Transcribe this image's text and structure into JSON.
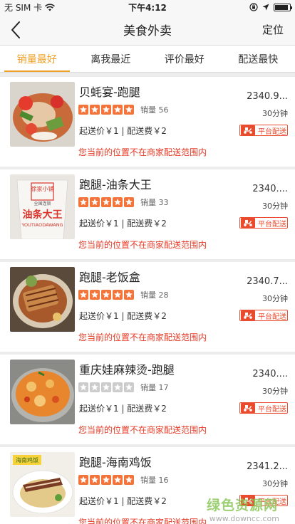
{
  "status_bar": {
    "carrier": "无 SIM 卡",
    "time": "下午4:12",
    "icons": [
      "wifi-icon",
      "lock-rotation-icon",
      "location-icon",
      "battery-icon"
    ]
  },
  "nav": {
    "title": "美食外卖",
    "action": "定位",
    "back_icon": "back-chevron-icon"
  },
  "tabs": [
    {
      "label": "销量最好",
      "active": true
    },
    {
      "label": "离我最近",
      "active": false
    },
    {
      "label": "评价最好",
      "active": false
    },
    {
      "label": "配送最快",
      "active": false
    }
  ],
  "colors": {
    "accent": "#f0a12a",
    "star": "#f2743a",
    "star_empty": "#cccccc",
    "alert_red": "#e83a25",
    "badge_red": "#e84b2d"
  },
  "shops": [
    {
      "name": "贝蚝宴-跑腿",
      "distance": "2340.9...",
      "stars": 5,
      "sales": "销量 56",
      "time": "30分钟",
      "fees": "起送价￥1 | 配送费￥2",
      "badge": "平台配送",
      "notice": "您当前的位置不在商家配送范围内",
      "image": "seafood-salad-photo"
    },
    {
      "name": "跑腿-油条大王",
      "distance": "2340....",
      "stars": 5,
      "sales": "销量 33",
      "time": "30分钟",
      "fees": "起送价￥1 | 配送费￥2",
      "badge": "平台配送",
      "notice": "您当前的位置不在商家配送范围内",
      "image": "youtiao-cup-photo",
      "image_text": [
        "徐家小铺",
        "全国连锁",
        "油条大王",
        "YOUTIAODAWANG"
      ]
    },
    {
      "name": "跑腿-老饭盒",
      "distance": "2340.7...",
      "stars": 5,
      "sales": "销量 28",
      "time": "30分钟",
      "fees": "起送价￥1 | 配送费￥2",
      "badge": "平台配送",
      "notice": "您当前的位置不在商家配送范围内",
      "image": "rice-box-photo"
    },
    {
      "name": "重庆娃麻辣烫-跑腿",
      "distance": "2340....",
      "stars": 0,
      "sales": "销量 17",
      "time": "30分钟",
      "fees": "起送价￥1 | 配送费￥2",
      "badge": "平台配送",
      "notice": "您当前的位置不在商家配送范围内",
      "image": "malatang-pot-photo"
    },
    {
      "name": "跑腿-海南鸡饭",
      "distance": "2341.2...",
      "stars": 5,
      "sales": "销量 16",
      "time": "30分钟",
      "fees": "起送价￥1 | 配送费￥2",
      "badge": "平台配送",
      "notice": "您当前的位置不在商家配送范围内",
      "image": "hainan-chicken-rice-photo",
      "image_text": [
        "海南鸡饭"
      ]
    }
  ],
  "watermark": {
    "line1": "绿色资源网",
    "line2": "www.downcc.com"
  }
}
